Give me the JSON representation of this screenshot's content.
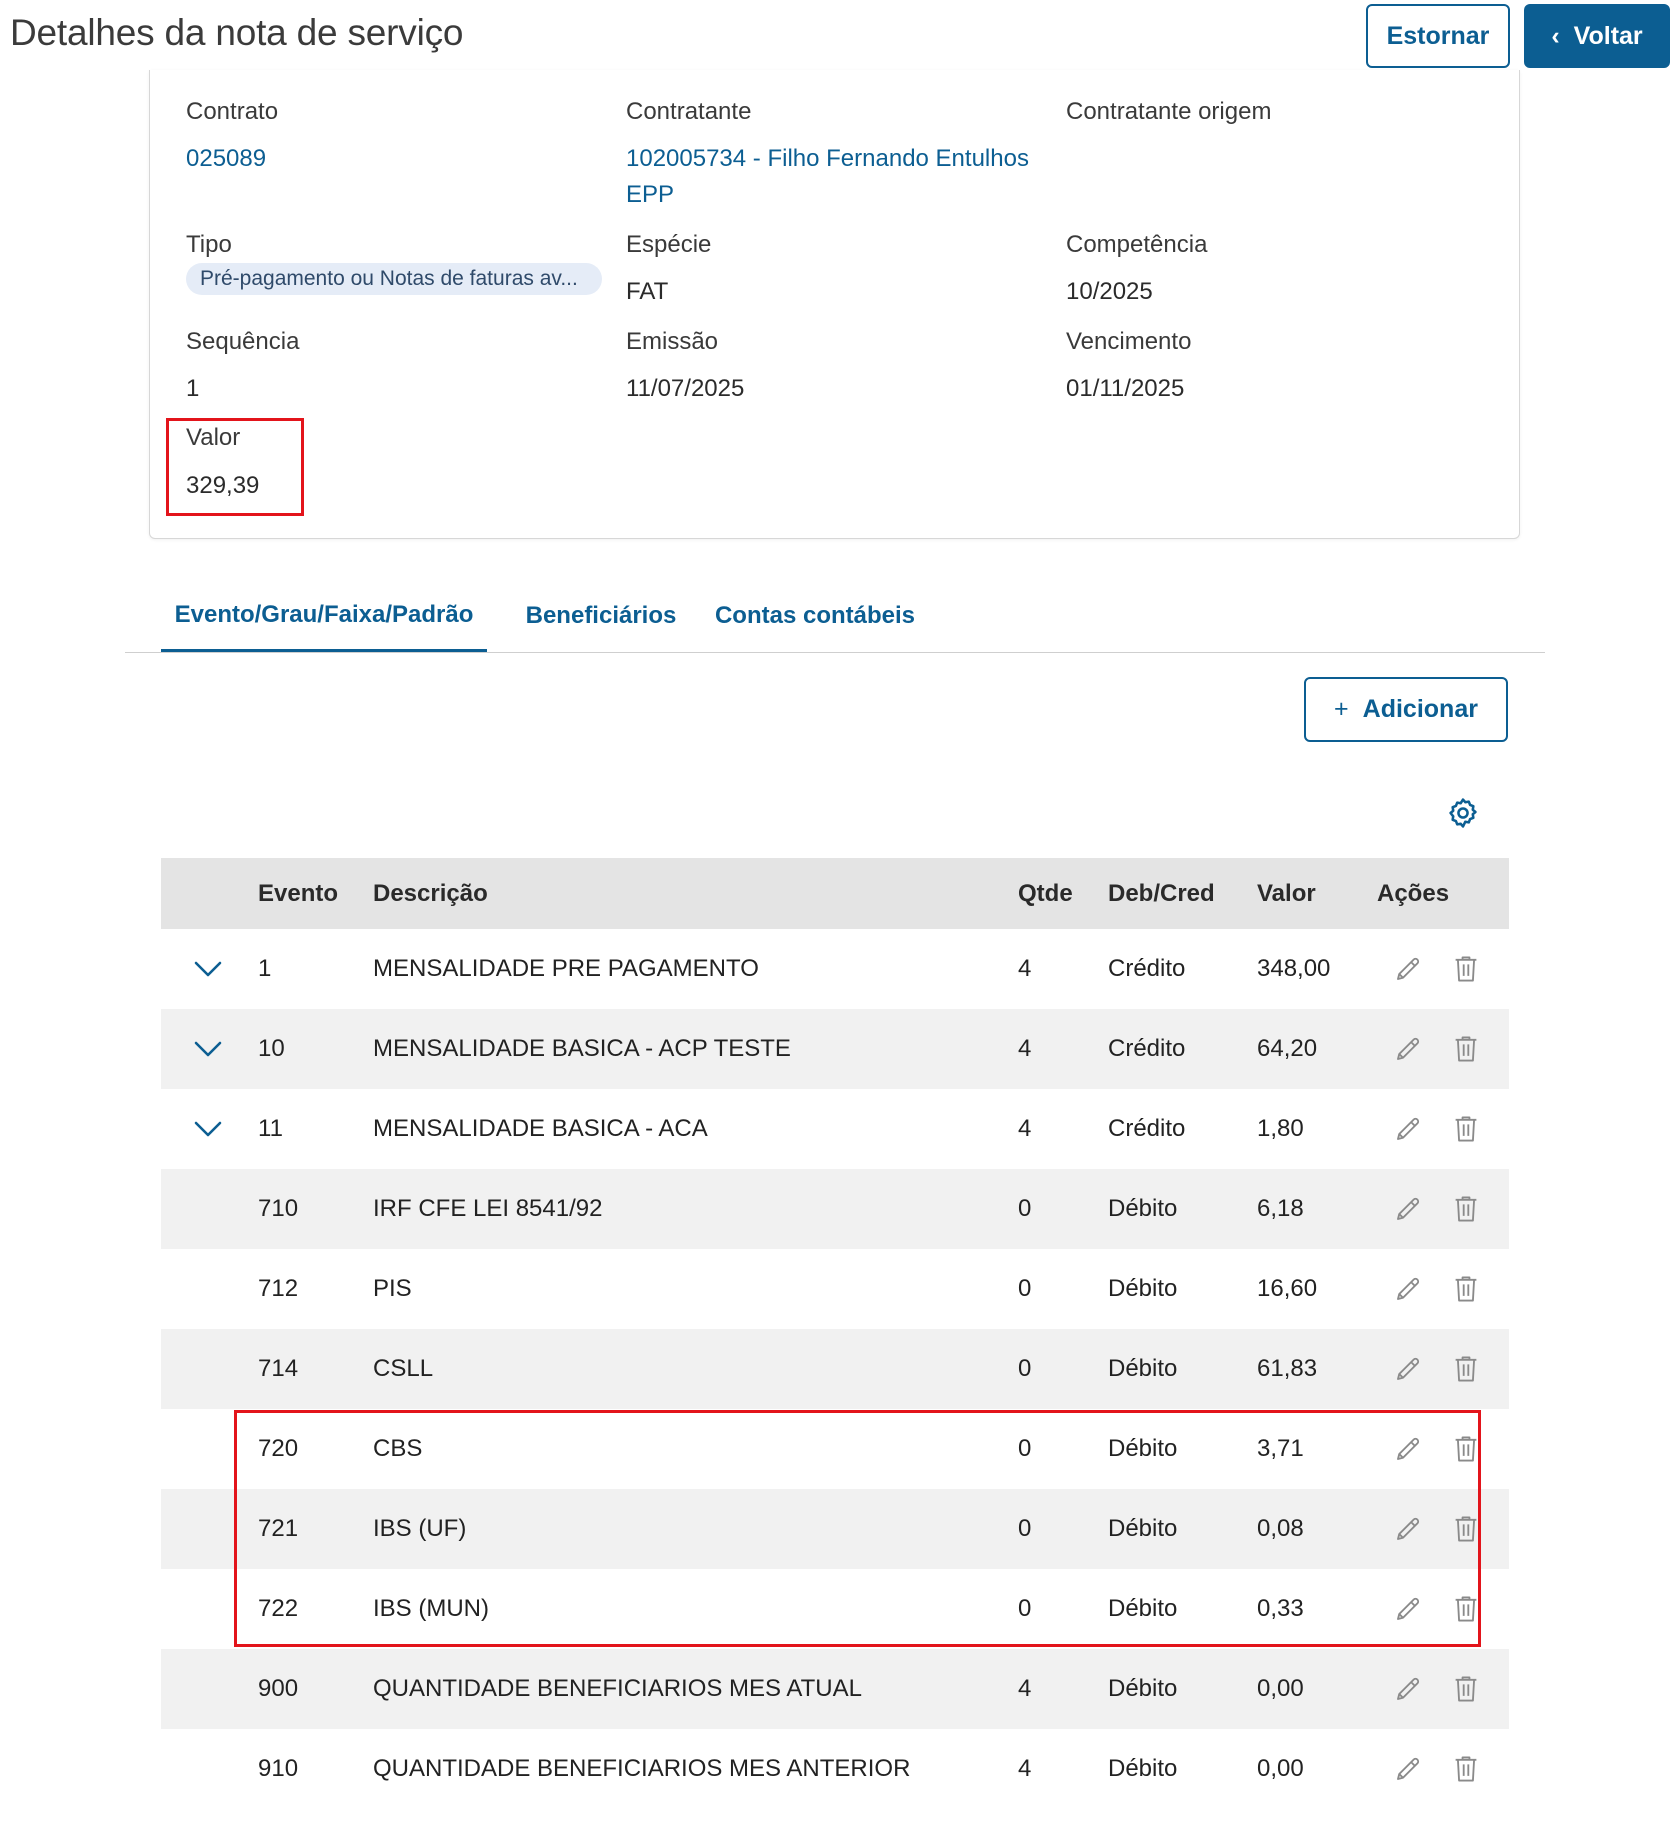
{
  "header": {
    "title": "Detalhes da nota de serviço",
    "estornar_label": "Estornar",
    "voltar_label": "Voltar"
  },
  "details": {
    "contrato_label": "Contrato",
    "contrato_value": "025089",
    "contratante_label": "Contratante",
    "contratante_value_line1": "102005734 - Filho Fernando Entulhos",
    "contratante_value_line2": "EPP",
    "contratante_origem_label": "Contratante origem",
    "tipo_label": "Tipo",
    "tipo_value": "Pré-pagamento ou Notas de faturas av...",
    "especie_label": "Espécie",
    "especie_value": "FAT",
    "competencia_label": "Competência",
    "competencia_value": "10/2025",
    "sequencia_label": "Sequência",
    "sequencia_value": "1",
    "emissao_label": "Emissão",
    "emissao_value": "11/07/2025",
    "vencimento_label": "Vencimento",
    "vencimento_value": "01/11/2025",
    "valor_label": "Valor",
    "valor_value": "329,39"
  },
  "tabs": [
    {
      "label": "Evento/Grau/Faixa/Padrão",
      "active": true
    },
    {
      "label": "Beneficiários",
      "active": false
    },
    {
      "label": "Contas contábeis",
      "active": false
    }
  ],
  "actions": {
    "adicionar_label": "Adicionar",
    "settings_icon": "gear-icon"
  },
  "table": {
    "columns": [
      "Evento",
      "Descrição",
      "Qtde",
      "Deb/Cred",
      "Valor",
      "Ações"
    ],
    "rows": [
      {
        "evento": "1",
        "descricao": "MENSALIDADE PRE PAGAMENTO",
        "qtde": "4",
        "debcred": "Crédito",
        "valor": "348,00",
        "expandable": true
      },
      {
        "evento": "10",
        "descricao": "MENSALIDADE BASICA - ACP TESTE",
        "qtde": "4",
        "debcred": "Crédito",
        "valor": "64,20",
        "expandable": true
      },
      {
        "evento": "11",
        "descricao": "MENSALIDADE BASICA - ACA",
        "qtde": "4",
        "debcred": "Crédito",
        "valor": "1,80",
        "expandable": true
      },
      {
        "evento": "710",
        "descricao": "IRF CFE LEI 8541/92",
        "qtde": "0",
        "debcred": "Débito",
        "valor": "6,18",
        "expandable": false
      },
      {
        "evento": "712",
        "descricao": "PIS",
        "qtde": "0",
        "debcred": "Débito",
        "valor": "16,60",
        "expandable": false
      },
      {
        "evento": "714",
        "descricao": "CSLL",
        "qtde": "0",
        "debcred": "Débito",
        "valor": "61,83",
        "expandable": false
      },
      {
        "evento": "720",
        "descricao": "CBS",
        "qtde": "0",
        "debcred": "Débito",
        "valor": "3,71",
        "expandable": false
      },
      {
        "evento": "721",
        "descricao": "IBS (UF)",
        "qtde": "0",
        "debcred": "Débito",
        "valor": "0,08",
        "expandable": false
      },
      {
        "evento": "722",
        "descricao": "IBS (MUN)",
        "qtde": "0",
        "debcred": "Débito",
        "valor": "0,33",
        "expandable": false
      },
      {
        "evento": "900",
        "descricao": "QUANTIDADE BENEFICIARIOS MES ATUAL",
        "qtde": "4",
        "debcred": "Débito",
        "valor": "0,00",
        "expandable": false
      },
      {
        "evento": "910",
        "descricao": "QUANTIDADE BENEFICIARIOS MES ANTERIOR",
        "qtde": "4",
        "debcred": "Débito",
        "valor": "0,00",
        "expandable": false
      }
    ]
  },
  "colors": {
    "primary": "#0c5e92",
    "highlight": "#e3141b",
    "row_alt": "#f1f1f1",
    "header_bg": "#e4e4e4"
  }
}
